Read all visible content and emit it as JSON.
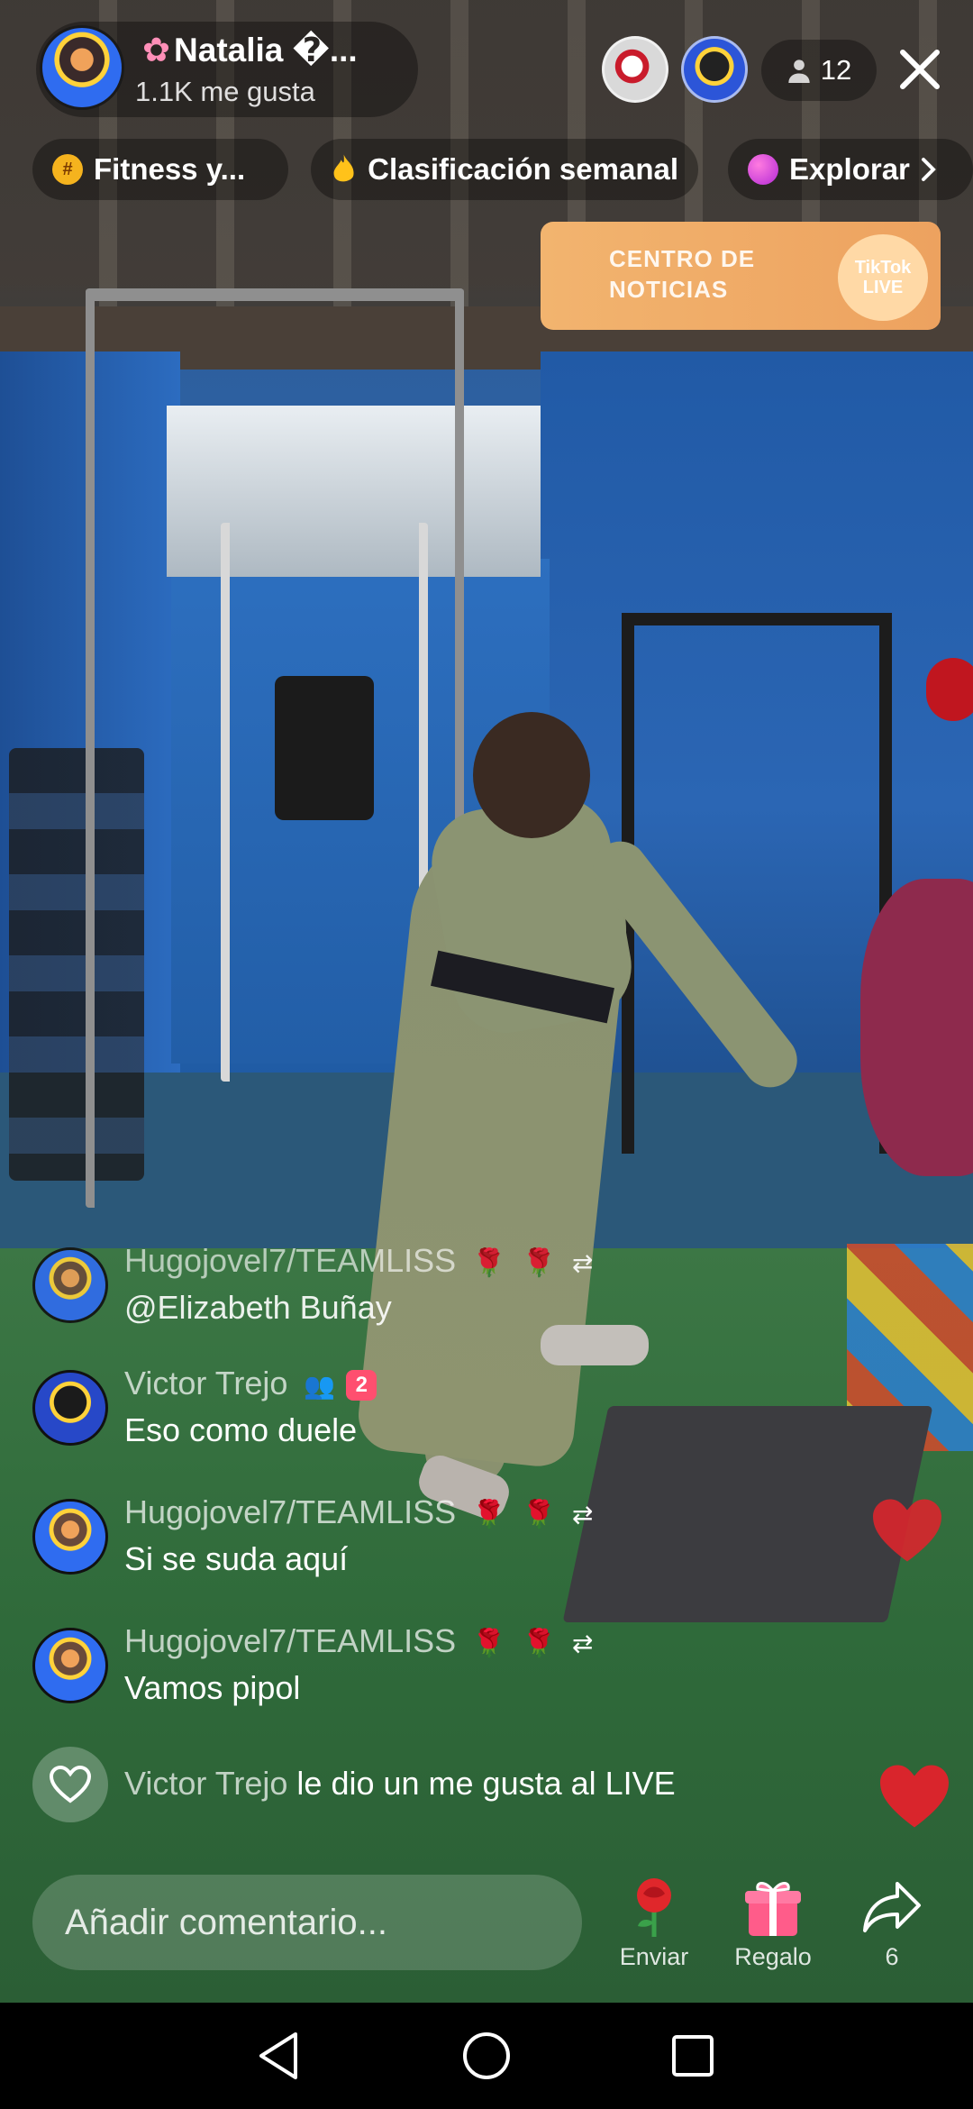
{
  "host": {
    "name": "Natalia �...",
    "likes": "1.1K me gusta"
  },
  "viewers": {
    "count": "12"
  },
  "chips": [
    {
      "label": "Fitness y...",
      "icon": "hashtag-icon"
    },
    {
      "label": "Clasificación semanal",
      "icon": "flame-icon"
    },
    {
      "label": "Explorar",
      "icon": "planet-icon"
    }
  ],
  "news_banner": {
    "line1": "CENTRO DE",
    "line2": "NOTICIAS",
    "badge_line1": "TikTok",
    "badge_line2": "LIVE"
  },
  "comments": [
    {
      "user": "Hugojovel7/TEAMLISS",
      "text": "@Elizabeth Buñay"
    },
    {
      "user": "Victor Trejo",
      "text": "Eso como duele",
      "rank": "2"
    },
    {
      "user": "Hugojovel7/TEAMLISS",
      "text": "Si se suda aquí"
    },
    {
      "user": "Hugojovel7/TEAMLISS",
      "text": "Vamos pipol"
    }
  ],
  "like_event": {
    "user": "Victor Trejo",
    "text": "le dio un me gusta al LIVE"
  },
  "composer": {
    "placeholder": "Añadir comentario..."
  },
  "actions": {
    "send_label": "Enviar",
    "gift_label": "Regalo",
    "share_count": "6"
  },
  "colors": {
    "heart": "#e0272b",
    "gift": "#ff5c8a",
    "rose": "#e0272b"
  }
}
